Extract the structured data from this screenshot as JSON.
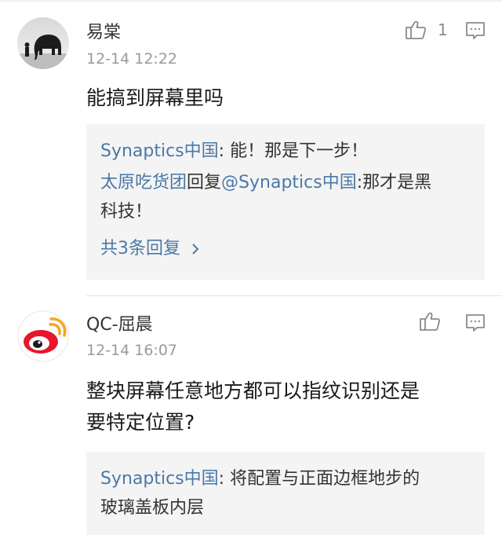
{
  "comments": [
    {
      "username": "易棠",
      "time": "12-14 12:22",
      "like_count": "1",
      "text": "能搞到屏幕里吗",
      "replies": [
        {
          "author": "Synaptics中国",
          "sep": ": ",
          "text": "能！那是下一步！"
        },
        {
          "author": "太原吃货团",
          "mid": "回复",
          "mention": "@Synaptics中国",
          "sep": ":",
          "text_line1": "那才是黑",
          "text_line2": "科技！"
        }
      ],
      "more_replies": "共3条回复",
      "avatar_icon": "elephant-avatar-icon"
    },
    {
      "username": "QC-屈晨",
      "time": "12-14 16:07",
      "like_count": "",
      "text_line1": "整块屏幕任意地方都可以指纹识别还是",
      "text_line2": "要特定位置?",
      "replies": [
        {
          "author": "Synaptics中国",
          "sep": ": ",
          "text_line1": "将配置与正面边框地步的",
          "text_line2": "玻璃盖板内层"
        }
      ],
      "avatar_icon": "weibo-logo-avatar-icon"
    }
  ],
  "colors": {
    "link": "#4a78a8",
    "reply_bg": "#f4f4f4",
    "weibo_red": "#e6162d"
  }
}
